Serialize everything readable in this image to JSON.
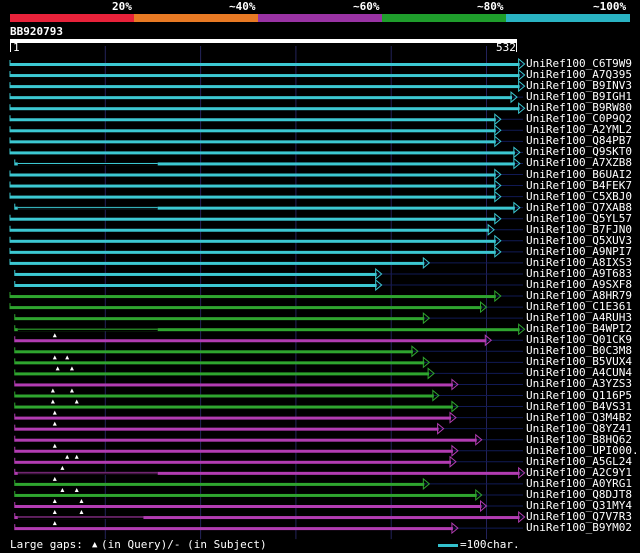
{
  "scale": {
    "labels": [
      "20%",
      "~40%",
      "~60%",
      "~80%",
      "~100%"
    ],
    "colors": [
      "#e8223a",
      "#e87a24",
      "#9a33a4",
      "#1f9e2c",
      "#2ab3c3"
    ]
  },
  "query": {
    "name": "BB920793",
    "start_label": "1",
    "end_label": "532",
    "length": 532
  },
  "colors": {
    "cyan": "#3cc8d2",
    "green": "#2fa52f",
    "magenta": "#b23cb2",
    "navy": "#111a55",
    "grid": "#23235a"
  },
  "hits": [
    {
      "name": "UniRef100_C6T9W9",
      "color": "cyan",
      "start": 0,
      "end": 540,
      "cut": 0,
      "gaps": []
    },
    {
      "name": "UniRef100_A7Q395",
      "color": "cyan",
      "start": 0,
      "end": 540,
      "cut": 0,
      "gaps": []
    },
    {
      "name": "UniRef100_B9INV3",
      "color": "cyan",
      "start": 0,
      "end": 540,
      "cut": 0,
      "gaps": []
    },
    {
      "name": "UniRef100_B9IGH1",
      "color": "cyan",
      "start": 0,
      "end": 532,
      "cut": 0,
      "gaps": []
    },
    {
      "name": "UniRef100_B9RW80",
      "color": "cyan",
      "start": 0,
      "end": 540,
      "cut": 0,
      "gaps": []
    },
    {
      "name": "UniRef100_C0P9Q2",
      "color": "cyan",
      "start": 0,
      "end": 515,
      "cut": 0,
      "gaps": []
    },
    {
      "name": "UniRef100_A2YML2",
      "color": "cyan",
      "start": 0,
      "end": 515,
      "cut": 0,
      "gaps": []
    },
    {
      "name": "UniRef100_Q84PB7",
      "color": "cyan",
      "start": 0,
      "end": 515,
      "cut": 0,
      "gaps": []
    },
    {
      "name": "UniRef100_Q9SKT0",
      "color": "cyan",
      "start": 0,
      "end": 535,
      "cut": 0,
      "gaps": []
    },
    {
      "name": "UniRef100_A7XZB8",
      "color": "cyan",
      "start": 5,
      "end": 535,
      "cut": 155,
      "gaps": []
    },
    {
      "name": "UniRef100_B6UAI2",
      "color": "cyan",
      "start": 0,
      "end": 515,
      "cut": 0,
      "gaps": []
    },
    {
      "name": "UniRef100_B4FEK7",
      "color": "cyan",
      "start": 0,
      "end": 515,
      "cut": 0,
      "gaps": []
    },
    {
      "name": "UniRef100_C5XBJ0",
      "color": "cyan",
      "start": 0,
      "end": 515,
      "cut": 0,
      "gaps": []
    },
    {
      "name": "UniRef100_Q7XAB8",
      "color": "cyan",
      "start": 5,
      "end": 535,
      "cut": 155,
      "gaps": []
    },
    {
      "name": "UniRef100_Q5YL57",
      "color": "cyan",
      "start": 0,
      "end": 515,
      "cut": 0,
      "gaps": []
    },
    {
      "name": "UniRef100_B7FJN0",
      "color": "cyan",
      "start": 0,
      "end": 508,
      "cut": 0,
      "gaps": []
    },
    {
      "name": "UniRef100_Q5XUV3",
      "color": "cyan",
      "start": 0,
      "end": 515,
      "cut": 0,
      "gaps": []
    },
    {
      "name": "UniRef100_A9NPI7",
      "color": "cyan",
      "start": 0,
      "end": 515,
      "cut": 0,
      "gaps": []
    },
    {
      "name": "UniRef100_A8IXS3",
      "color": "cyan",
      "start": 0,
      "end": 440,
      "cut": 0,
      "gaps": []
    },
    {
      "name": "UniRef100_A9T683",
      "color": "cyan",
      "start": 5,
      "end": 390,
      "cut": 0,
      "gaps": []
    },
    {
      "name": "UniRef100_A9SXF8",
      "color": "cyan",
      "start": 5,
      "end": 390,
      "cut": 0,
      "gaps": []
    },
    {
      "name": "UniRef100_A8HR79",
      "color": "green",
      "start": 0,
      "end": 515,
      "cut": 0,
      "gaps": []
    },
    {
      "name": "UniRef100_C1E361",
      "color": "green",
      "start": 0,
      "end": 500,
      "cut": 0,
      "gaps": []
    },
    {
      "name": "UniRef100_A4RUH3",
      "color": "green",
      "start": 5,
      "end": 440,
      "cut": 0,
      "gaps": []
    },
    {
      "name": "UniRef100_B4WPI2",
      "color": "green",
      "start": 5,
      "end": 540,
      "cut": 155,
      "gaps": []
    },
    {
      "name": "UniRef100_Q01CK9",
      "color": "magenta",
      "start": 5,
      "end": 505,
      "cut": 0,
      "gaps": [
        47
      ]
    },
    {
      "name": "UniRef100_B0C3M8",
      "color": "green",
      "start": 5,
      "end": 428,
      "cut": 0,
      "gaps": []
    },
    {
      "name": "UniRef100_B5VUX4",
      "color": "green",
      "start": 5,
      "end": 440,
      "cut": 0,
      "gaps": [
        47,
        60
      ]
    },
    {
      "name": "UniRef100_A4CUN4",
      "color": "green",
      "start": 5,
      "end": 445,
      "cut": 0,
      "gaps": [
        50,
        65
      ]
    },
    {
      "name": "UniRef100_A3YZS3",
      "color": "magenta",
      "start": 5,
      "end": 470,
      "cut": 0,
      "gaps": []
    },
    {
      "name": "UniRef100_Q116P5",
      "color": "green",
      "start": 5,
      "end": 450,
      "cut": 0,
      "gaps": [
        45,
        65
      ]
    },
    {
      "name": "UniRef100_B4VS31",
      "color": "green",
      "start": 5,
      "end": 470,
      "cut": 0,
      "gaps": [
        45,
        70
      ]
    },
    {
      "name": "UniRef100_Q3M4B2",
      "color": "magenta",
      "start": 5,
      "end": 468,
      "cut": 0,
      "gaps": [
        47
      ]
    },
    {
      "name": "UniRef100_Q8YZ41",
      "color": "magenta",
      "start": 5,
      "end": 455,
      "cut": 0,
      "gaps": [
        47
      ]
    },
    {
      "name": "UniRef100_B8HQ62",
      "color": "magenta",
      "start": 5,
      "end": 495,
      "cut": 0,
      "gaps": []
    },
    {
      "name": "UniRef100_UPI000...",
      "color": "magenta",
      "start": 5,
      "end": 470,
      "cut": 0,
      "gaps": [
        47
      ]
    },
    {
      "name": "UniRef100_A5GL24",
      "color": "magenta",
      "start": 5,
      "end": 468,
      "cut": 0,
      "gaps": [
        60,
        70
      ]
    },
    {
      "name": "UniRef100_A2C9Y1",
      "color": "magenta",
      "start": 5,
      "end": 540,
      "cut": 155,
      "gaps": [
        55
      ]
    },
    {
      "name": "UniRef100_A0YRG1",
      "color": "green",
      "start": 5,
      "end": 440,
      "cut": 0,
      "gaps": [
        47
      ]
    },
    {
      "name": "UniRef100_Q8DJT8",
      "color": "green",
      "start": 5,
      "end": 495,
      "cut": 0,
      "gaps": [
        55,
        70
      ]
    },
    {
      "name": "UniRef100_Q31MY4",
      "color": "magenta",
      "start": 5,
      "end": 500,
      "cut": 0,
      "gaps": [
        47,
        75
      ]
    },
    {
      "name": "UniRef100_Q7V7R3",
      "color": "magenta",
      "start": 5,
      "end": 540,
      "cut": 140,
      "gaps": [
        47,
        75
      ]
    },
    {
      "name": "UniRef100_B9YM02",
      "color": "magenta",
      "start": 5,
      "end": 470,
      "cut": 0,
      "gaps": [
        47
      ]
    }
  ],
  "footer": {
    "gaps_label": "Large gaps:",
    "query_marker": "▲",
    "query_text": "(in Query)/- (in Subject)",
    "legend_text": "=100char."
  }
}
